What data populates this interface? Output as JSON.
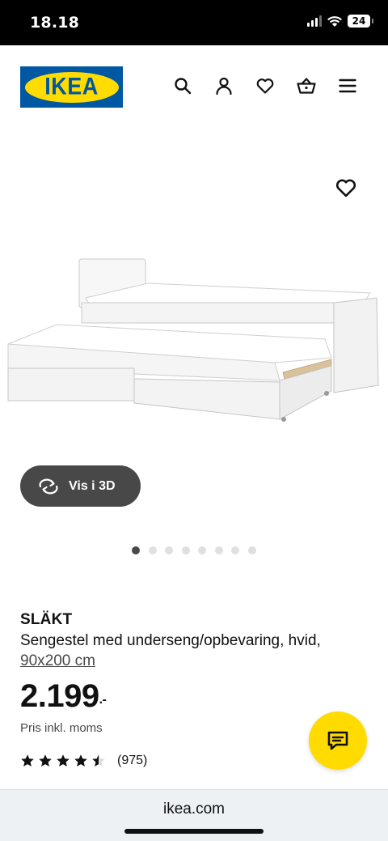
{
  "status_bar": {
    "time": "18.18",
    "battery": "24"
  },
  "header": {
    "logo_text": "IKEA",
    "icons": [
      "search-icon",
      "profile-icon",
      "heart-icon",
      "basket-icon",
      "menu-icon"
    ]
  },
  "gallery": {
    "view3d_label": "Vis i 3D",
    "dot_count": 8,
    "active_dot": 0
  },
  "product": {
    "name": "SLÄKT",
    "description": "Sengestel med underseng/opbevaring, hvid,",
    "size": "90x200 cm",
    "price": "2.199",
    "price_suffix": ".-",
    "price_note": "Pris inkl. moms",
    "rating_stars": 4.5,
    "rating_count": "(975)"
  },
  "browser": {
    "url": "ikea.com"
  },
  "colors": {
    "ikea_blue": "#0058a3",
    "ikea_yellow": "#ffdb00",
    "dark_pill": "#484848"
  }
}
